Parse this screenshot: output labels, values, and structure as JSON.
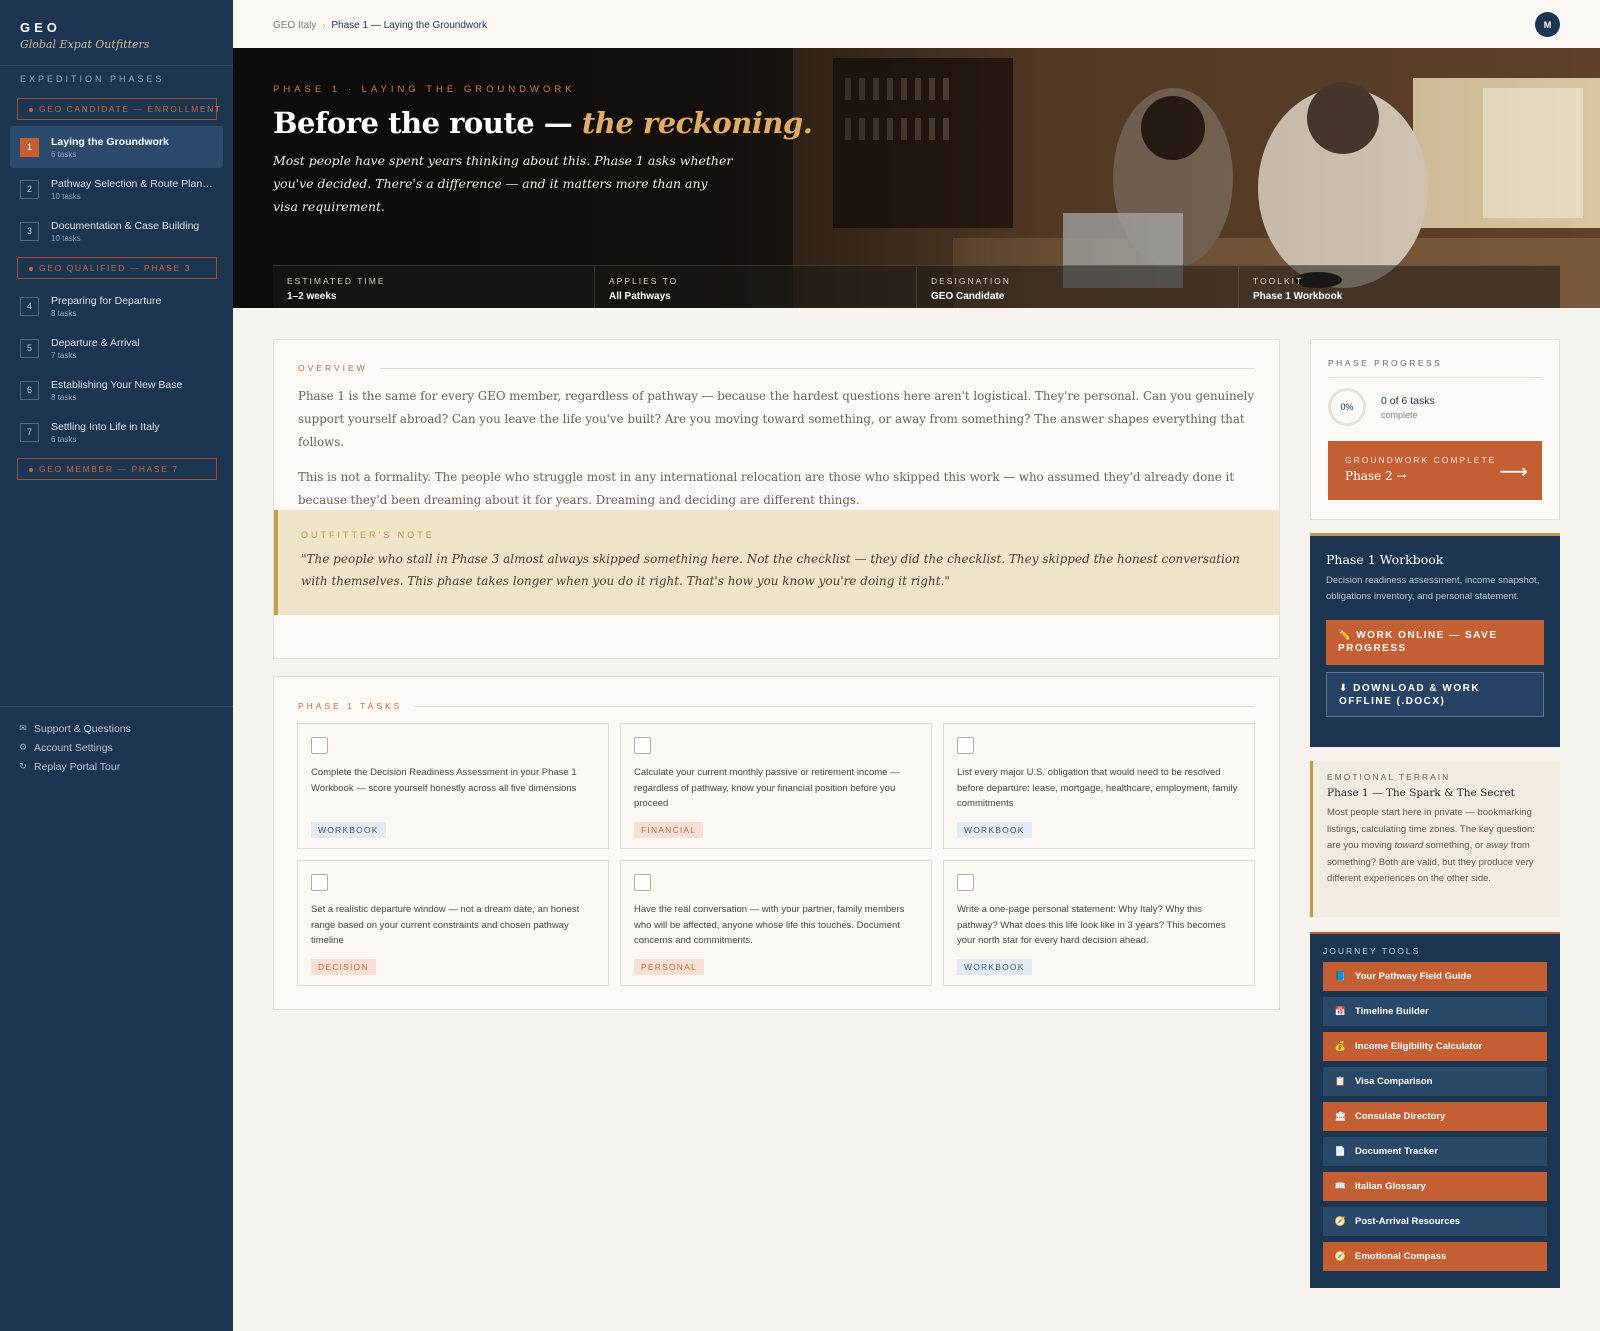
{
  "brand": {
    "title": "GEO",
    "subtitle": "Global Expat Outfitters"
  },
  "sidebar": {
    "heading": "EXPEDITION PHASES",
    "badges": [
      "GEO CANDIDATE — ENROLLMENT",
      "GEO QUALIFIED — PHASE 3",
      "GEO MEMBER — PHASE 7"
    ],
    "phases": [
      {
        "num": "1",
        "name": "Laying the Groundwork",
        "tasks": "6 tasks"
      },
      {
        "num": "2",
        "name": "Pathway Selection & Route Planni...",
        "tasks": "10 tasks"
      },
      {
        "num": "3",
        "name": "Documentation & Case Building",
        "tasks": "10 tasks"
      },
      {
        "num": "4",
        "name": "Preparing for Departure",
        "tasks": "8 tasks"
      },
      {
        "num": "5",
        "name": "Departure & Arrival",
        "tasks": "7 tasks"
      },
      {
        "num": "6",
        "name": "Establishing Your New Base",
        "tasks": "8 tasks"
      },
      {
        "num": "7",
        "name": "Settling Into Life in Italy",
        "tasks": "6 tasks"
      }
    ],
    "footer": [
      "Support & Questions",
      "Account Settings",
      "Replay Portal Tour"
    ]
  },
  "topbar": {
    "crumb_root": "GEO Italy",
    "crumb_current": "Phase 1 — Laying the Groundwork",
    "avatar": "M"
  },
  "hero": {
    "kicker": "PHASE 1 · LAYING THE GROUNDWORK",
    "title_main": "Before the route —",
    "title_accent": "the reckoning.",
    "description": "Most people have spent years thinking about this. Phase 1 asks whether you've decided. There's a difference — and it matters more than any visa requirement.",
    "meta": [
      {
        "label": "ESTIMATED TIME",
        "value": "1–2 weeks"
      },
      {
        "label": "APPLIES TO",
        "value": "All Pathways"
      },
      {
        "label": "DESIGNATION",
        "value": "GEO Candidate"
      },
      {
        "label": "TOOLKIT",
        "value": "Phase 1 Workbook"
      }
    ]
  },
  "overview": {
    "label": "OVERVIEW",
    "p1": "Phase 1 is the same for every GEO member, regardless of pathway — because the hardest questions here aren't logistical. They're personal. Can you genuinely support yourself abroad? Can you leave the life you've built? Are you moving toward something, or away from something? The answer shapes everything that follows.",
    "p2": "This is not a formality. The people who struggle most in any international relocation are those who skipped this work — who assumed they'd already done it because they'd been dreaming about it for years. Dreaming and deciding are different things.",
    "note_label": "OUTFITTER'S NOTE",
    "note_text": "\"The people who stall in Phase 3 almost always skipped something here. Not the checklist — they did the checklist. They skipped the honest conversation with themselves. This phase takes longer when you do it right. That's how you know you're doing it right.\""
  },
  "tasks": {
    "label": "PHASE 1 TASKS",
    "items": [
      {
        "text": "Complete the Decision Readiness Assessment in your Phase 1 Workbook — score yourself honestly across all five dimensions",
        "tag": "WORKBOOK",
        "tag_color": "blue"
      },
      {
        "text": "Calculate your current monthly passive or retirement income — regardless of pathway, know your financial position before you proceed",
        "tag": "FINANCIAL",
        "tag_color": "red"
      },
      {
        "text": "List every major U.S. obligation that would need to be resolved before departure: lease, mortgage, healthcare, employment, family commitments",
        "tag": "WORKBOOK",
        "tag_color": "blue"
      },
      {
        "text": "Set a realistic departure window — not a dream date, an honest range based on your current constraints and chosen pathway timeline",
        "tag": "DECISION",
        "tag_color": "red"
      },
      {
        "text": "Have the real conversation — with your partner, family members who will be affected, anyone whose life this touches. Document concerns and commitments.",
        "tag": "PERSONAL",
        "tag_color": "red"
      },
      {
        "text": "Write a one-page personal statement: Why Italy? Why this pathway? What does this life look like in 3 years? This becomes your north star for every hard decision ahead.",
        "tag": "WORKBOOK",
        "tag_color": "blue"
      }
    ]
  },
  "progress": {
    "label": "PHASE PROGRESS",
    "percent": "0%",
    "count": "0 of 6 tasks",
    "count_sub": "complete",
    "button_kicker": "GROUNDWORK COMPLETE",
    "button_label": "Phase 2 →",
    "button_arrow": "⟶"
  },
  "workbook": {
    "title": "Phase 1 Workbook",
    "description": "Decision readiness assessment, income snapshot, obligations inventory, and personal statement.",
    "primary": "✏️ WORK ONLINE — SAVE PROGRESS",
    "secondary": "⬇ DOWNLOAD & WORK OFFLINE (.DOCX)"
  },
  "terrain": {
    "label": "EMOTIONAL TERRAIN",
    "title": "Phase 1 — The Spark & The Secret",
    "body_a": "Most people start here in private — bookmarking listings, calculating time zones. The key question: are you moving ",
    "body_em1": "toward",
    "body_b": " something, or ",
    "body_em2": "away",
    "body_c": " from something? Both are valid, but they produce very different experiences on the other side."
  },
  "tools": {
    "label": "JOURNEY TOOLS",
    "items": [
      {
        "label": "Your Pathway Field Guide",
        "icon": "📘",
        "color": "orange"
      },
      {
        "label": "Timeline Builder",
        "icon": "📅",
        "color": "navy"
      },
      {
        "label": "Income Eligibility Calculator",
        "icon": "💰",
        "color": "orange"
      },
      {
        "label": "Visa Comparison",
        "icon": "📋",
        "color": "navy"
      },
      {
        "label": "Consulate Directory",
        "icon": "🏛",
        "color": "orange"
      },
      {
        "label": "Document Tracker",
        "icon": "📄",
        "color": "navy"
      },
      {
        "label": "Italian Glossary",
        "icon": "📖",
        "color": "orange"
      },
      {
        "label": "Post-Arrival Resources",
        "icon": "🧭",
        "color": "navy"
      },
      {
        "label": "Emotional Compass",
        "icon": "🧭",
        "color": "orange"
      }
    ]
  }
}
